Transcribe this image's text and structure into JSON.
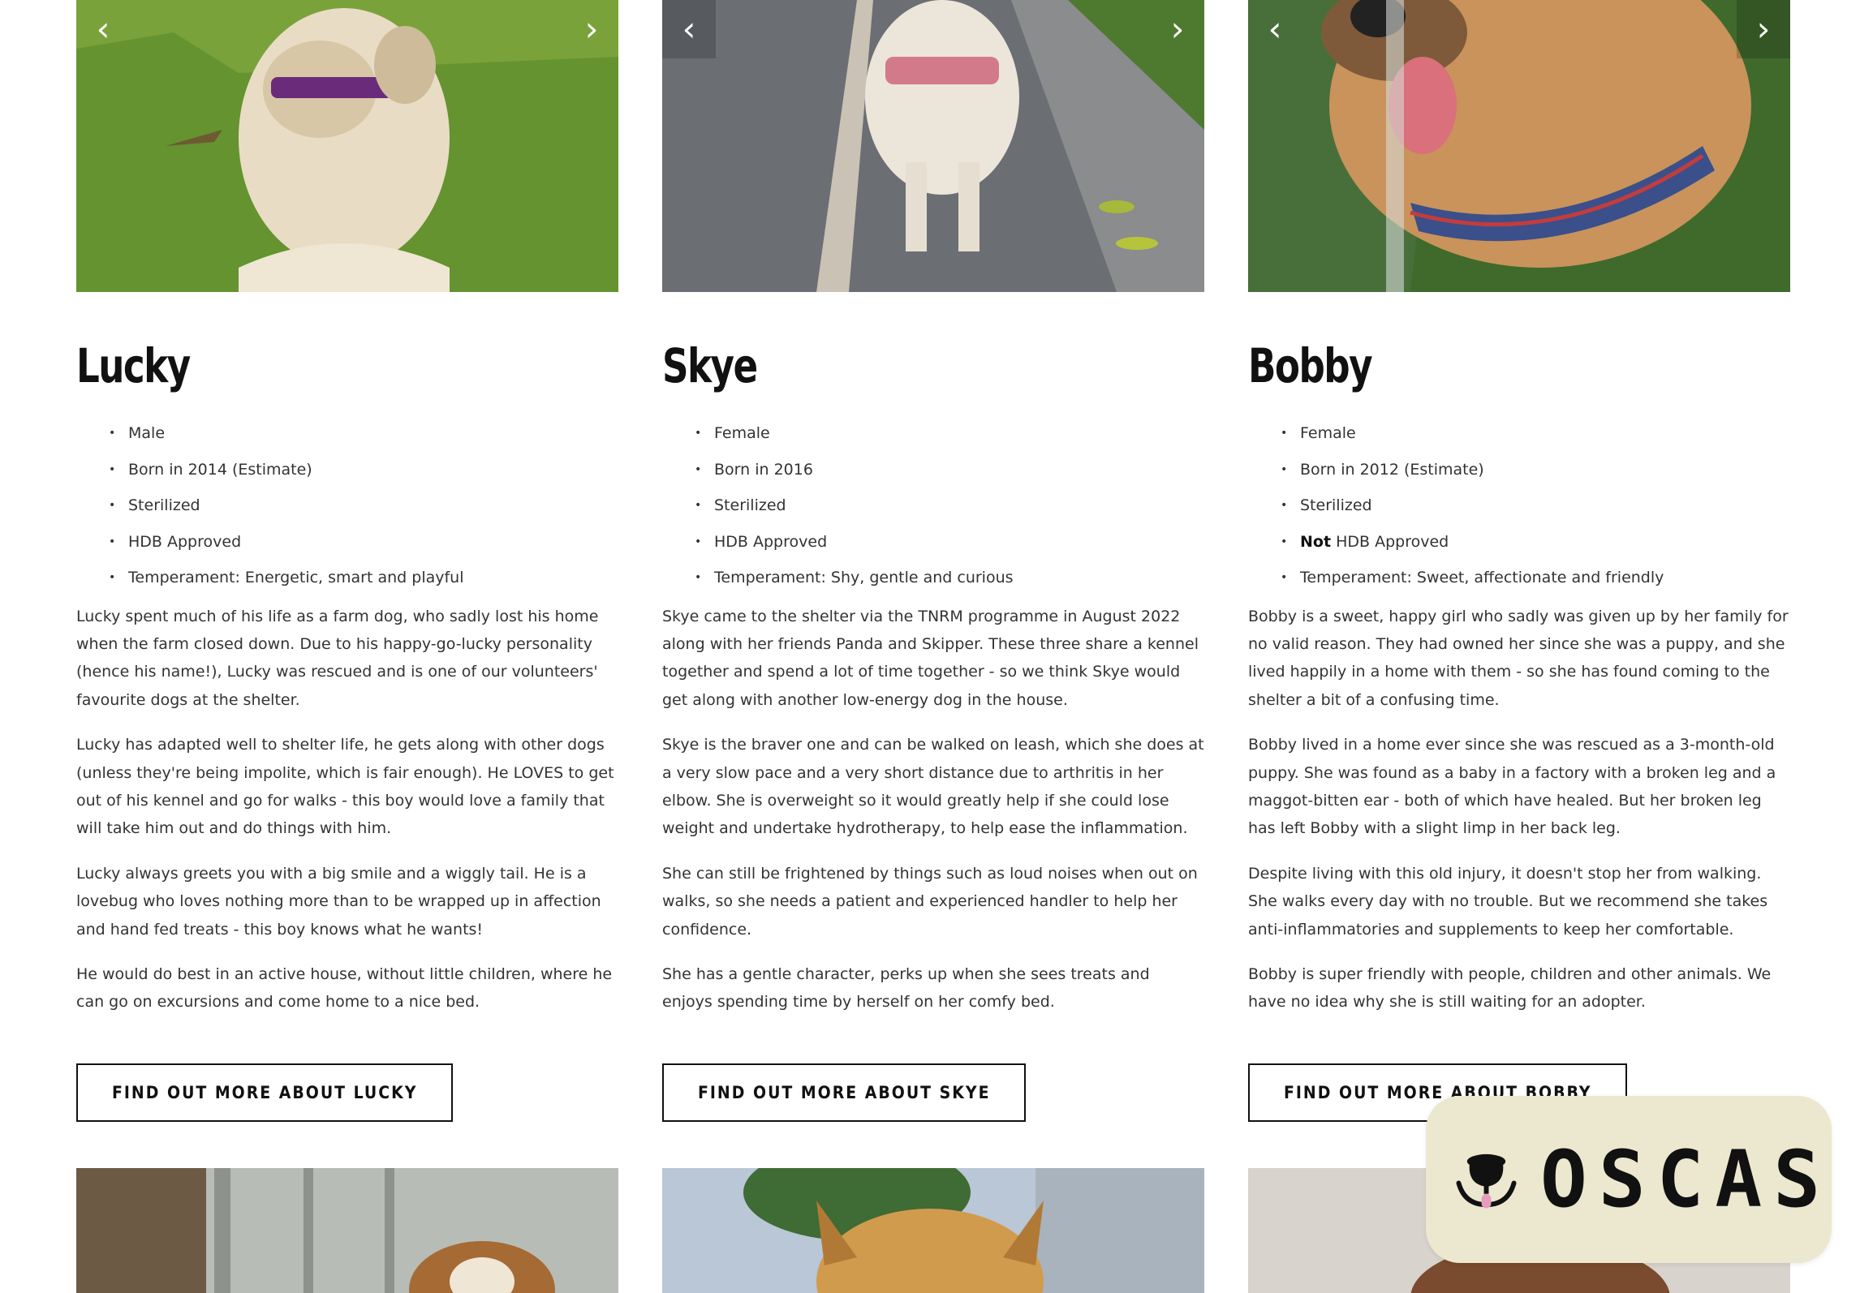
{
  "colors": {
    "text": "#333333",
    "heading": "#111111",
    "button_border": "#111111",
    "brand_bg": "#ebe8cf",
    "grass": "#5a8a2a",
    "asphalt": "#6b6e73"
  },
  "carousel_icons": {
    "prev": "‹",
    "next": "›"
  },
  "dogs": [
    {
      "name": "Lucky",
      "facts": [
        "Male",
        "Born in 2014 (Estimate)",
        "Sterilized",
        "HDB Approved",
        "Temperament: Energetic, smart and playful"
      ],
      "hdb_prefix": "",
      "paragraphs": [
        "Lucky spent much of his life as a farm dog, who sadly lost his home when the farm closed down. Due to his happy-go-lucky personality (hence his name!), Lucky was rescued and is one of our volunteers' favourite dogs at the shelter.",
        "Lucky has adapted well to shelter life, he gets along with other dogs (unless they're being impolite, which is fair enough). He LOVES to get out of his kennel and go for walks - this boy would love a family that will take him out and do things with him.",
        "Lucky always greets you with a big smile and a wiggly tail. He is a lovebug who loves nothing more than to be wrapped up in affection and hand fed treats - this boy knows what he wants!",
        "He would do best in an active house, without little children, where he can go on excursions and come home to a nice bed."
      ],
      "button": "FIND OUT MORE ABOUT LUCKY"
    },
    {
      "name": "Skye",
      "facts": [
        "Female",
        "Born in 2016",
        "Sterilized",
        "HDB Approved",
        "Temperament: Shy, gentle and curious"
      ],
      "hdb_prefix": "",
      "paragraphs": [
        "Skye came to the shelter via the TNRM programme in August 2022 along with her friends Panda and Skipper. These three share a kennel together and spend a lot of time together - so we think Skye would get along with another low-energy dog in the house.",
        "Skye is the braver one and can be walked on leash, which she does at a very slow pace and a very short distance due to arthritis in her elbow. She is overweight so it would greatly help if she could lose weight and undertake hydrotherapy, to help ease the inflammation.",
        "She can still be frightened by things such as loud noises when out on walks, so she needs a patient and experienced handler to help her confidence.",
        "She has a gentle character, perks up when she sees treats and enjoys spending time by herself on her comfy bed."
      ],
      "button": "FIND OUT MORE ABOUT SKYE"
    },
    {
      "name": "Bobby",
      "facts": [
        "Female",
        "Born in 2012 (Estimate)",
        "Sterilized",
        "HDB Approved",
        "Temperament: Sweet, affectionate and friendly"
      ],
      "hdb_prefix": "Not",
      "paragraphs": [
        "Bobby is a sweet, happy girl who sadly was given up by her family for no valid reason. They had owned her since she was a puppy, and she lived happily in a home with them - so she has found coming to the shelter a bit of a confusing time.",
        "Bobby lived in a home ever since she was rescued as a 3-month-old puppy. She was found as a baby in a factory with a broken leg and a maggot-bitten ear - both of which have healed. But her broken leg has left Bobby with a slight limp in her back leg.",
        "Despite living with this old injury, it doesn't stop her from walking. She walks every day with no trouble. But we recommend she takes anti-inflammatories and supplements to keep her comfortable.",
        "Bobby is super friendly with people, children and other animals. We have no idea why she is still waiting for an adopter."
      ],
      "button": "FIND OUT MORE ABOUT BOBBY"
    }
  ],
  "brand": {
    "name": "OSCAS"
  }
}
